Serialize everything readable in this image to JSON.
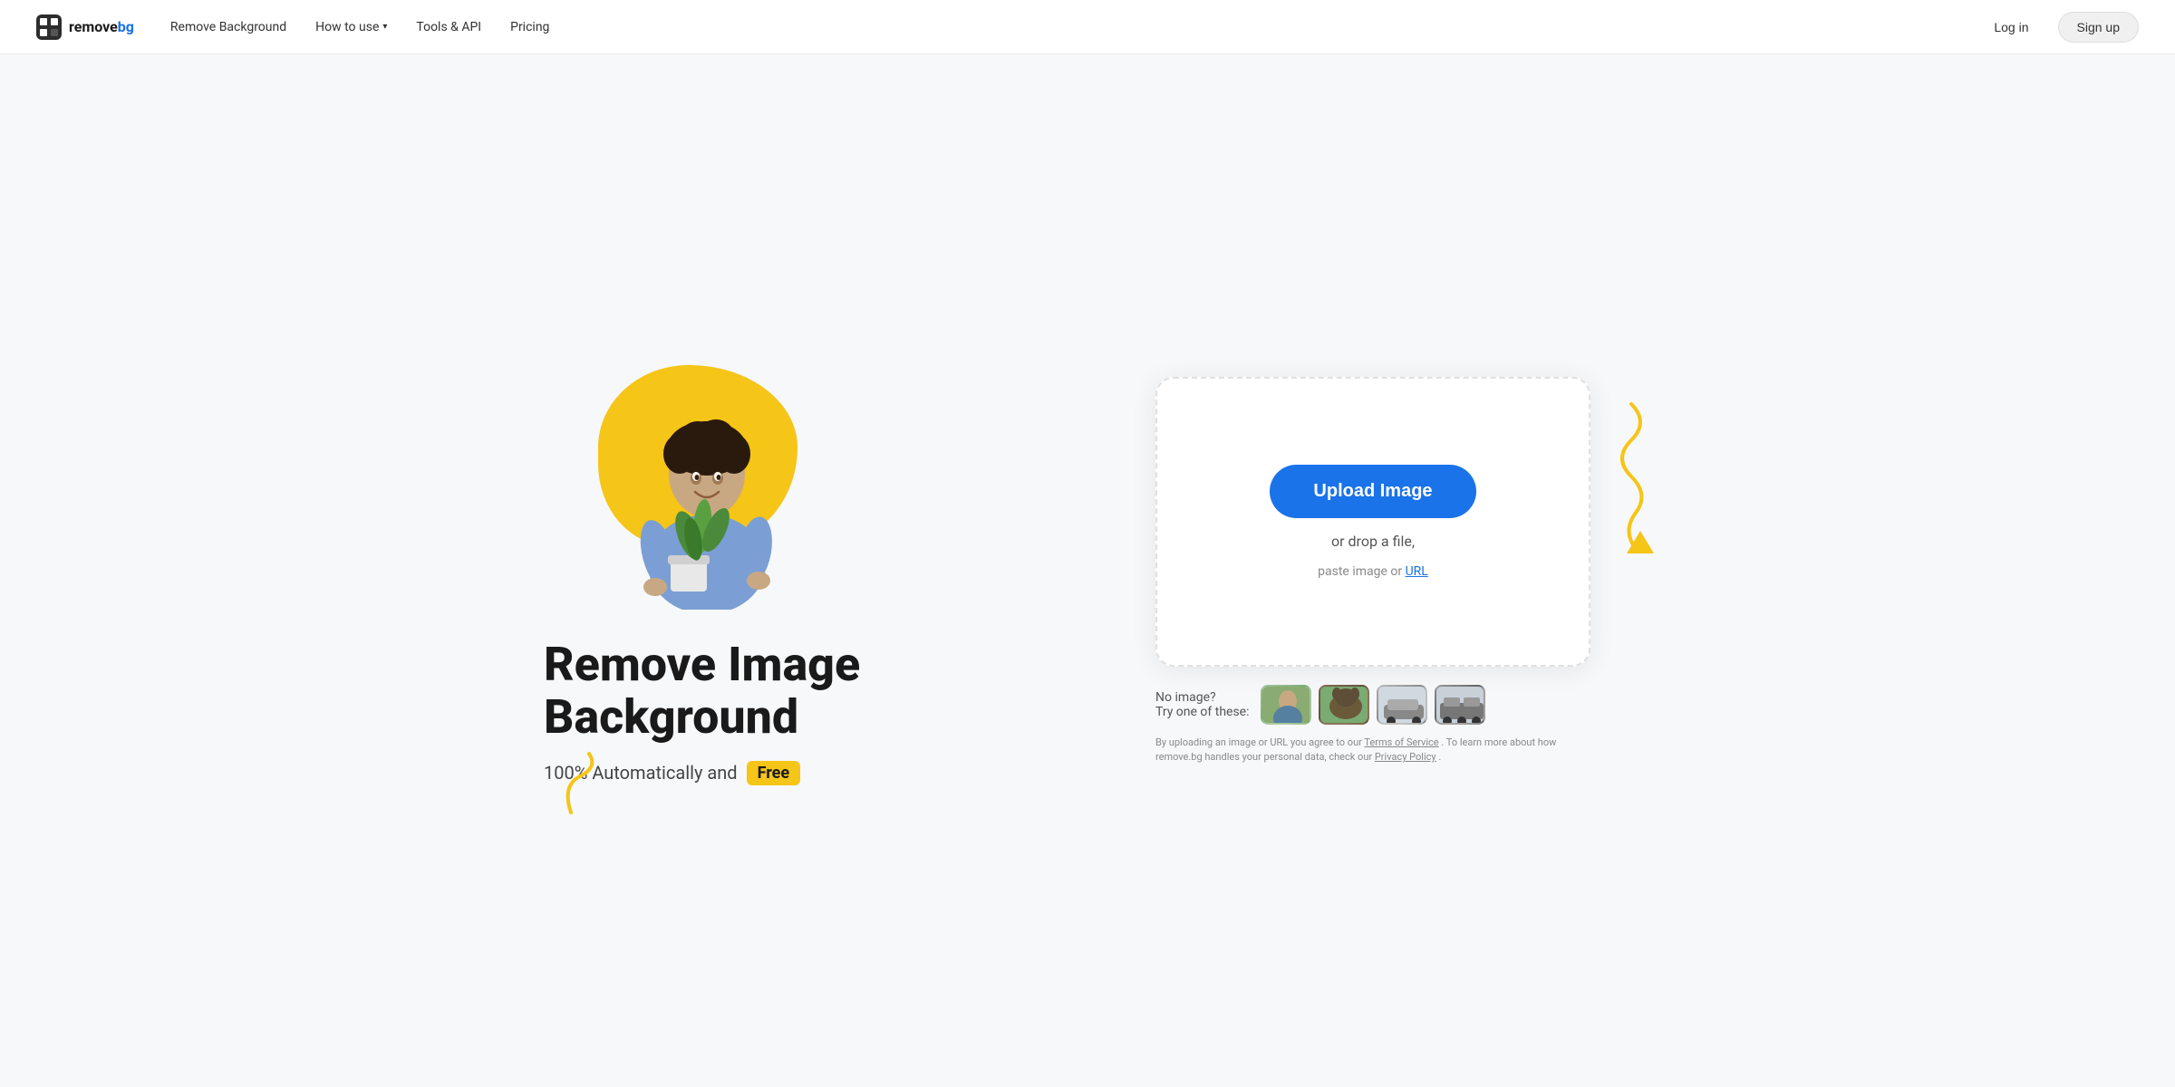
{
  "nav": {
    "logo_remove": "remove",
    "logo_bg": "bg",
    "links": [
      {
        "label": "Remove Background",
        "id": "remove-background",
        "hasDropdown": false
      },
      {
        "label": "How to use",
        "id": "how-to-use",
        "hasDropdown": true
      },
      {
        "label": "Tools & API",
        "id": "tools-api",
        "hasDropdown": false
      },
      {
        "label": "Pricing",
        "id": "pricing",
        "hasDropdown": false
      }
    ],
    "login_label": "Log in",
    "signup_label": "Sign up"
  },
  "hero": {
    "headline_line1": "Remove Image",
    "headline_line2": "Background",
    "subtitle_prefix": "100% Automatically and",
    "badge_free": "Free"
  },
  "upload": {
    "button_label": "Upload Image",
    "drop_text": "or drop a file,",
    "paste_text_prefix": "paste image or",
    "paste_link": "URL"
  },
  "samples": {
    "no_image_text": "No image?",
    "try_text": "Try one of these:",
    "items": [
      {
        "id": "person1",
        "alt": "Person sample"
      },
      {
        "id": "animal",
        "alt": "Animal sample"
      },
      {
        "id": "car",
        "alt": "Car sample"
      },
      {
        "id": "vehicle",
        "alt": "Vehicle sample"
      }
    ]
  },
  "disclaimer": {
    "text_prefix": "By uploading an image or URL you agree to our",
    "tos_link": "Terms of Service",
    "text_middle": ". To learn more about how remove.bg handles your personal data, check our",
    "privacy_link": "Privacy Policy",
    "text_suffix": "."
  }
}
